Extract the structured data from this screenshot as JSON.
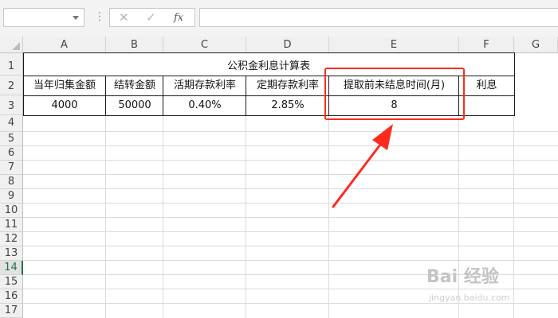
{
  "formula_bar": {
    "name_box": "",
    "dots": "⋮",
    "cancel_icon": "✕",
    "confirm_icon": "✓",
    "fx_label": "fx",
    "formula": ""
  },
  "columns": [
    "A",
    "B",
    "C",
    "D",
    "E",
    "F",
    "G"
  ],
  "rows": [
    "1",
    "2",
    "3",
    "4",
    "5",
    "6",
    "7",
    "8",
    "9",
    "10",
    "11",
    "12",
    "13",
    "14",
    "15",
    "16",
    "17"
  ],
  "active_row": "14",
  "sheet": {
    "title": "公积金利息计算表",
    "headers": [
      "当年归集金额",
      "结转金额",
      "活期存款利率",
      "定期存款利率",
      "提取前未结息时间(月)",
      "利息"
    ],
    "values": [
      "4000",
      "50000",
      "0.40%",
      "2.85%",
      "8",
      ""
    ]
  },
  "annotation": {
    "color": "#ff2a1f"
  },
  "watermark": {
    "text": "Bai 经验",
    "sub": "jingyan.baidu.com"
  }
}
